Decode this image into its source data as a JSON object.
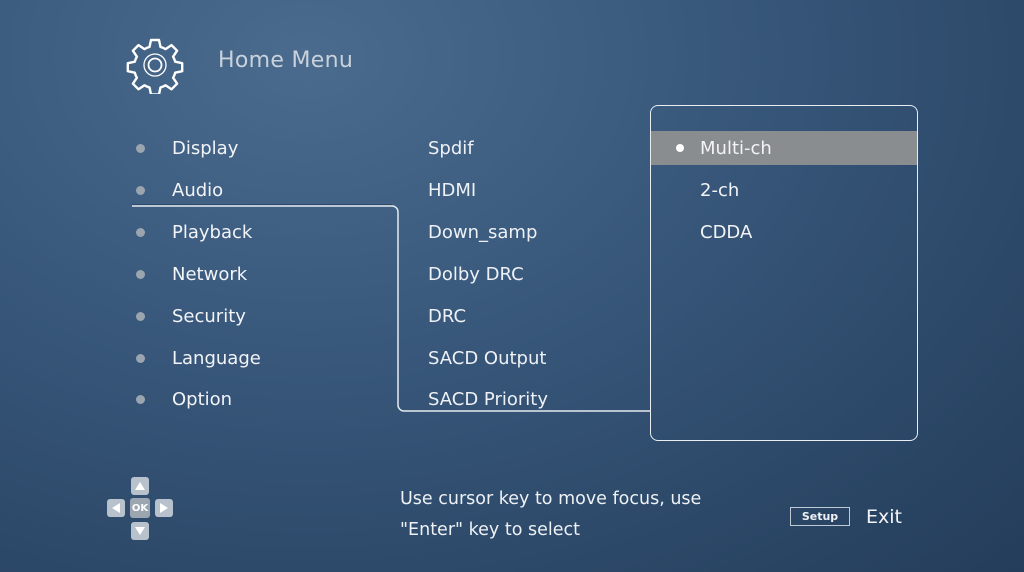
{
  "header": {
    "icon": "gear-icon",
    "title": "Home Menu"
  },
  "main_menu": {
    "items": [
      {
        "label": "Display"
      },
      {
        "label": "Audio",
        "active": true
      },
      {
        "label": "Playback"
      },
      {
        "label": "Network"
      },
      {
        "label": "Security"
      },
      {
        "label": "Language"
      },
      {
        "label": "Option"
      }
    ]
  },
  "sub_menu": {
    "items": [
      {
        "label": "Spdif",
        "active": true
      },
      {
        "label": "HDMI"
      },
      {
        "label": "Down_samp"
      },
      {
        "label": "Dolby DRC"
      },
      {
        "label": "DRC"
      },
      {
        "label": "SACD Output"
      },
      {
        "label": "SACD Priority"
      }
    ]
  },
  "options": {
    "items": [
      {
        "label": "Multi-ch",
        "selected": true
      },
      {
        "label": "2-ch"
      },
      {
        "label": "CDDA"
      }
    ],
    "highlight_color": "#8a8d90"
  },
  "footer": {
    "dpad": {
      "up": "▲",
      "down": "▼",
      "left": "◀",
      "right": "▶",
      "ok": "OK"
    },
    "help_line1": "Use cursor key to move focus, use",
    "help_line2": "\"Enter\" key to select",
    "setup_key": "Setup",
    "exit_label": "Exit"
  }
}
